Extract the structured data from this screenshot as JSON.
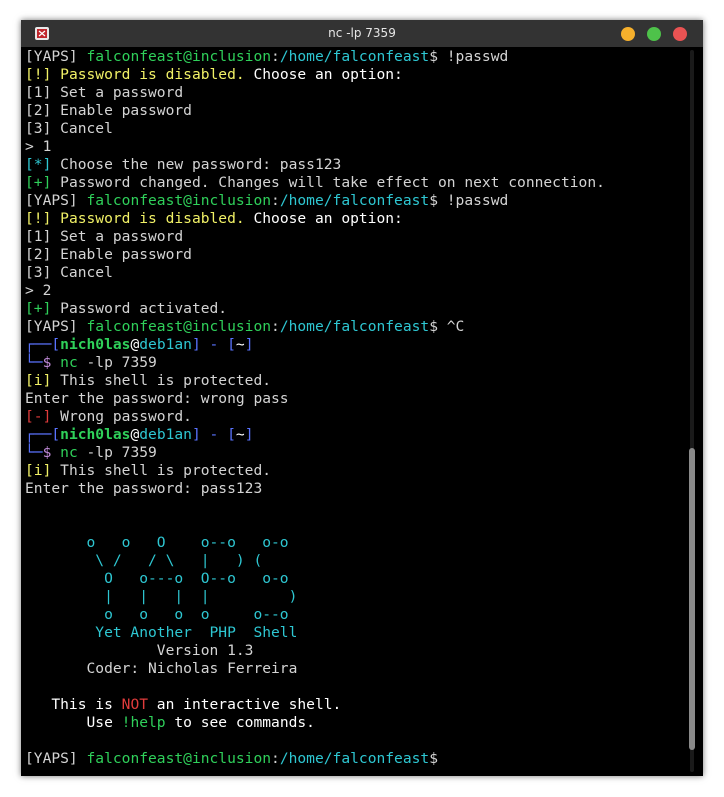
{
  "window": {
    "title": "nc -lp 7359",
    "icons": {
      "app": "terminal-app-icon",
      "minimize": "minimize-button",
      "maximize": "maximize-button",
      "close": "close-button"
    },
    "colors": {
      "minimize": "#f6b02c",
      "maximize": "#4ec24a",
      "close": "#ea5353",
      "titlebar": "#333333",
      "terminal_bg": "#000000"
    }
  },
  "terminal": {
    "lines": [
      [
        [
          "[YAPS] ",
          ""
        ],
        [
          "falconfeast@inclusion",
          "g"
        ],
        [
          ":",
          ""
        ],
        [
          "/home/falconfeast",
          "cy"
        ],
        [
          "$ !passwd",
          ""
        ]
      ],
      [
        [
          "[!] ",
          "y"
        ],
        [
          "Password is disabled.",
          "y"
        ],
        [
          " Choose an option:",
          "w"
        ]
      ],
      [
        [
          "[1] Set a password",
          ""
        ]
      ],
      [
        [
          "[2] Enable password",
          ""
        ]
      ],
      [
        [
          "[3] Cancel",
          ""
        ]
      ],
      [
        [
          "> 1",
          ""
        ]
      ],
      [
        [
          "[*] ",
          "c"
        ],
        [
          "Choose the new password: pass123",
          ""
        ]
      ],
      [
        [
          "[+] ",
          "g"
        ],
        [
          "Password changed. Changes will take effect on next connection.",
          ""
        ]
      ],
      [
        [
          "[YAPS] ",
          ""
        ],
        [
          "falconfeast@inclusion",
          "g"
        ],
        [
          ":",
          ""
        ],
        [
          "/home/falconfeast",
          "cy"
        ],
        [
          "$ !passwd",
          ""
        ]
      ],
      [
        [
          "[!] ",
          "y"
        ],
        [
          "Password is disabled.",
          "y"
        ],
        [
          " Choose an option:",
          "w"
        ]
      ],
      [
        [
          "[1] Set a password",
          ""
        ]
      ],
      [
        [
          "[2] Enable password",
          ""
        ]
      ],
      [
        [
          "[3] Cancel",
          ""
        ]
      ],
      [
        [
          "> 2",
          ""
        ]
      ],
      [
        [
          "[+] ",
          "g"
        ],
        [
          "Password activated.",
          ""
        ]
      ],
      [
        [
          "[YAPS] ",
          ""
        ],
        [
          "falconfeast@inclusion",
          "g"
        ],
        [
          ":",
          ""
        ],
        [
          "/home/falconfeast",
          "cy"
        ],
        [
          "$ ^C",
          ""
        ]
      ],
      [
        [
          "┌──[",
          "bb"
        ],
        [
          "nich0las",
          "gb"
        ],
        [
          "@",
          "w"
        ],
        [
          "deb1an",
          "c"
        ],
        [
          "] - [",
          "bb"
        ],
        [
          "~",
          "w"
        ],
        [
          "]",
          "bb"
        ]
      ],
      [
        [
          "└─",
          "bb"
        ],
        [
          "$ ",
          "m"
        ],
        [
          "nc",
          "g"
        ],
        [
          " -lp 7359",
          ""
        ]
      ],
      [
        [
          "[i] ",
          "y"
        ],
        [
          "This shell is protected.",
          ""
        ]
      ],
      [
        [
          "Enter the password: wrong pass",
          ""
        ]
      ],
      [
        [
          "[-] ",
          "r"
        ],
        [
          "Wrong password.",
          ""
        ]
      ],
      [
        [
          "┌──[",
          "bb"
        ],
        [
          "nich0las",
          "gb"
        ],
        [
          "@",
          "w"
        ],
        [
          "deb1an",
          "c"
        ],
        [
          "] - [",
          "bb"
        ],
        [
          "~",
          "w"
        ],
        [
          "]",
          "bb"
        ]
      ],
      [
        [
          "└─",
          "bb"
        ],
        [
          "$ ",
          "m"
        ],
        [
          "nc",
          "g"
        ],
        [
          " -lp 7359",
          ""
        ]
      ],
      [
        [
          "[i] ",
          "y"
        ],
        [
          "This shell is protected.",
          ""
        ]
      ],
      [
        [
          "Enter the password: pass123",
          ""
        ]
      ],
      [
        [
          "",
          ""
        ]
      ],
      [
        [
          "",
          ""
        ]
      ],
      [
        [
          "       o   o   O    o--o   o-o",
          "c"
        ]
      ],
      [
        [
          "        \\ /   / \\   |   ) (",
          "c"
        ]
      ],
      [
        [
          "         O   o---o  O--o   o-o",
          "c"
        ]
      ],
      [
        [
          "         |   |   |  |         )",
          "c"
        ]
      ],
      [
        [
          "         o   o   o  o     o--o",
          "c"
        ]
      ],
      [
        [
          "        Yet Another  PHP  Shell",
          "c"
        ]
      ],
      [
        [
          "               Version 1.3",
          ""
        ]
      ],
      [
        [
          "       Coder: Nicholas Ferreira",
          ""
        ]
      ],
      [
        [
          "",
          ""
        ]
      ],
      [
        [
          "   This is ",
          "w"
        ],
        [
          "NOT",
          "r"
        ],
        [
          " an interactive shell.",
          "w"
        ]
      ],
      [
        [
          "       Use ",
          "w"
        ],
        [
          "!help",
          "g"
        ],
        [
          " to see commands.",
          "w"
        ]
      ],
      [
        [
          "",
          ""
        ]
      ],
      [
        [
          "[YAPS] ",
          ""
        ],
        [
          "falconfeast@inclusion",
          "g"
        ],
        [
          ":",
          ""
        ],
        [
          "/home/falconfeast",
          "cy"
        ],
        [
          "$",
          ""
        ]
      ]
    ]
  },
  "scrollbar": {
    "position_fraction": 0.55,
    "visible_fraction": 0.42
  }
}
